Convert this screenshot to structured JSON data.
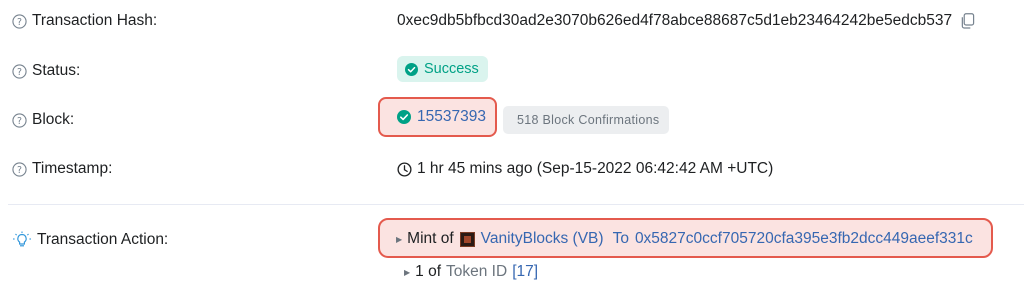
{
  "rows": {
    "hash": {
      "label": "Transaction Hash:",
      "value": "0xec9db5bfbcd30ad2e3070b626ed4f78abce88687c5d1eb23464242be5edcb537",
      "icon": "copy-icon"
    },
    "status": {
      "label": "Status:",
      "badge": "Success",
      "badge_color": "#00a186"
    },
    "block": {
      "label": "Block:",
      "number": "15537393",
      "confirmations": "518 Block Confirmations"
    },
    "timestamp": {
      "label": "Timestamp:",
      "value": "1 hr 45 mins ago (Sep-15-2022 06:42:42 AM +UTC)",
      "icon": "clock-icon"
    },
    "action": {
      "label": "Transaction Action:",
      "icon": "lightbulb-icon",
      "prefix": "Mint of",
      "token": "VanityBlocks (VB)",
      "to_label": "To",
      "to_address": "0x5827c0ccf705720cfa395e3fb2dcc449aeef331c",
      "sub_count": "1 of",
      "sub_token_label": "Token ID",
      "sub_token_id": "[17]"
    }
  },
  "colors": {
    "highlight_border": "#e45a4d",
    "highlight_fill": "#fbe3e1",
    "link": "#3667b1",
    "success": "#00a186"
  }
}
